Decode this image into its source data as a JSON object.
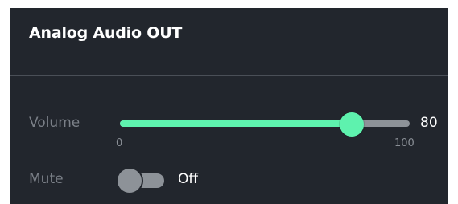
{
  "panel": {
    "title": "Analog Audio OUT"
  },
  "volume": {
    "label": "Volume",
    "value": 80,
    "value_text": "80",
    "min": 0,
    "max": 100,
    "min_text": "0",
    "max_text": "100"
  },
  "mute": {
    "label": "Mute",
    "state_text": "Off",
    "on": false
  },
  "colors": {
    "panel_background": "#22262d",
    "accent": "#5ef2ae",
    "track_inactive": "#8d9298",
    "label_text": "#7b8088",
    "value_text": "#ffffff"
  }
}
